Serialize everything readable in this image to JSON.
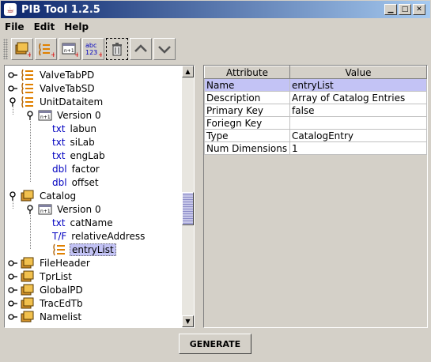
{
  "window": {
    "title": "PIB Tool 1.2.5"
  },
  "menu": [
    "File",
    "Edit",
    "Help"
  ],
  "toolbar": {
    "buttons": [
      {
        "name": "add-class-button",
        "icon": "class-add-icon"
      },
      {
        "name": "add-list-button",
        "icon": "list-add-icon"
      },
      {
        "name": "add-version-button",
        "icon": "version-add-icon"
      },
      {
        "name": "add-attribute-button",
        "icon": "abc123-icon",
        "icon_text": [
          "abc",
          "123"
        ]
      },
      {
        "name": "delete-button",
        "icon": "trash-icon"
      },
      {
        "name": "move-up-button",
        "icon": "chevron-up-icon"
      },
      {
        "name": "move-down-button",
        "icon": "chevron-down-icon"
      }
    ]
  },
  "tree": {
    "nodes": [
      {
        "label": "ValveTabPD",
        "icon": "list-icon",
        "handle": "collapsed",
        "level": 0
      },
      {
        "label": "ValveTabSD",
        "icon": "list-icon",
        "handle": "collapsed",
        "level": 0
      },
      {
        "label": "UnitDataitem",
        "icon": "list-icon",
        "handle": "expanded",
        "level": 0
      },
      {
        "label": "Version 0",
        "icon": "version-icon",
        "handle": "expanded",
        "level": 1
      },
      {
        "label": "labun",
        "tag": "txt",
        "level": 2
      },
      {
        "label": "siLab",
        "tag": "txt",
        "level": 2
      },
      {
        "label": "engLab",
        "tag": "txt",
        "level": 2
      },
      {
        "label": "factor",
        "tag": "dbl",
        "level": 2
      },
      {
        "label": "offset",
        "tag": "dbl",
        "level": 2
      },
      {
        "label": "Catalog",
        "icon": "class-icon",
        "handle": "expanded",
        "level": 0
      },
      {
        "label": "Version 0",
        "icon": "version-icon",
        "handle": "expanded",
        "level": 1
      },
      {
        "label": "catName",
        "tag": "txt",
        "level": 2
      },
      {
        "label": "relativeAddress",
        "tag": "T/F",
        "level": 2
      },
      {
        "label": "entryList",
        "icon": "list-icon",
        "level": 2,
        "selected": true
      },
      {
        "label": "FileHeader",
        "icon": "class-icon",
        "handle": "collapsed",
        "level": 0
      },
      {
        "label": "TprList",
        "icon": "class-icon",
        "handle": "collapsed",
        "level": 0
      },
      {
        "label": "GlobalPD",
        "icon": "class-icon",
        "handle": "collapsed",
        "level": 0
      },
      {
        "label": "TracEdTb",
        "icon": "class-icon",
        "handle": "collapsed",
        "level": 0
      },
      {
        "label": "Namelist",
        "icon": "class-icon",
        "handle": "collapsed",
        "level": 0
      }
    ]
  },
  "table": {
    "headers": [
      "Attribute",
      "Value"
    ],
    "rows": [
      {
        "attribute": "Name",
        "value": "entryList",
        "selected": true
      },
      {
        "attribute": "Description",
        "value": "Array of Catalog Entries"
      },
      {
        "attribute": "Primary Key",
        "value": "false"
      },
      {
        "attribute": "Foriegn Key",
        "value": ""
      },
      {
        "attribute": "Type",
        "value": "CatalogEntry"
      },
      {
        "attribute": "Num Dimensions",
        "value": "1"
      }
    ]
  },
  "footer": {
    "generate_label": "GENERATE"
  },
  "colors": {
    "title_start": "#0a246a",
    "title_end": "#a6caf0",
    "selection": "#c3c3f5",
    "tag_blue": "#0000c0"
  }
}
